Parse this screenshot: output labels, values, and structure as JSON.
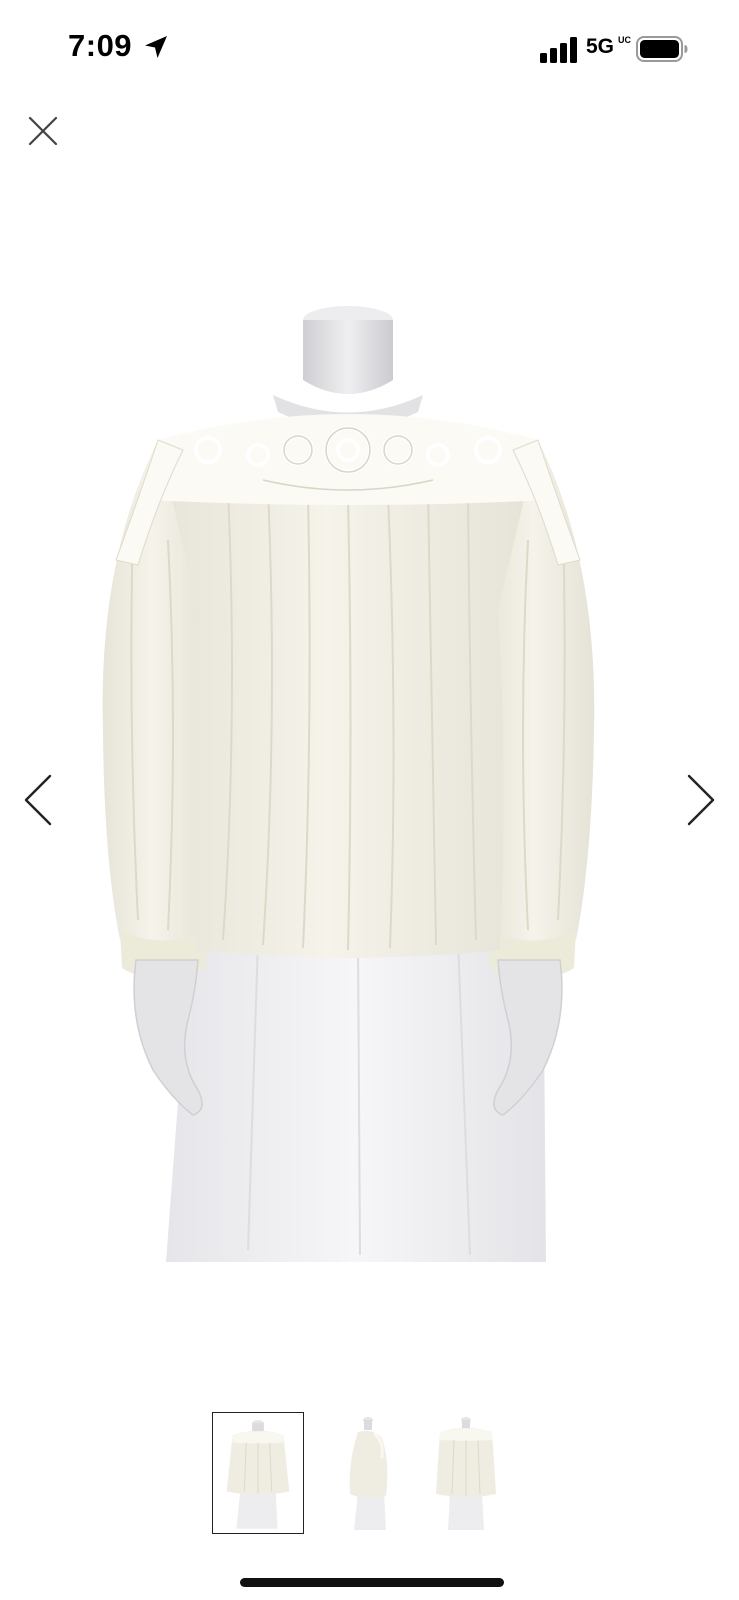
{
  "status_bar": {
    "time": "7:09",
    "network": "5G",
    "network_badge": "UC",
    "location_icon": "location-arrow-icon",
    "signal_icon": "cellular-signal-icon",
    "battery_icon": "battery-icon"
  },
  "viewer": {
    "close_icon": "close-icon",
    "prev_icon": "chevron-left-icon",
    "next_icon": "chevron-right-icon",
    "image_count": 3,
    "selected_index": 0
  },
  "colors": {
    "blouse": "#f3f1e6",
    "skirt": "#f2f2f5",
    "mannequin": "#e8e8ea",
    "lace": "#ffffff"
  }
}
